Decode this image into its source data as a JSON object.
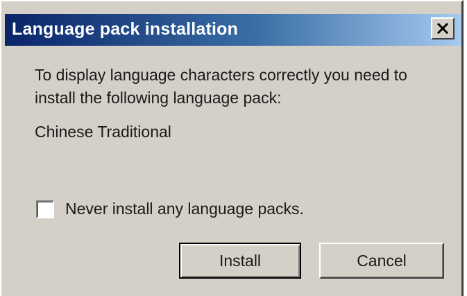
{
  "window": {
    "title": "Language pack installation",
    "close_icon": "close-x-icon"
  },
  "body": {
    "message": "To display language characters correctly you need to install the following language pack:",
    "language_pack": "Chinese Traditional"
  },
  "option": {
    "never_install_label": "Never install any language packs.",
    "checked": false
  },
  "buttons": {
    "install_label": "Install",
    "cancel_label": "Cancel"
  },
  "colors": {
    "titlebar_start": "#0a246a",
    "titlebar_end": "#a6caf0",
    "dialog_face": "#d4d0c8",
    "title_text": "#ffffff"
  }
}
